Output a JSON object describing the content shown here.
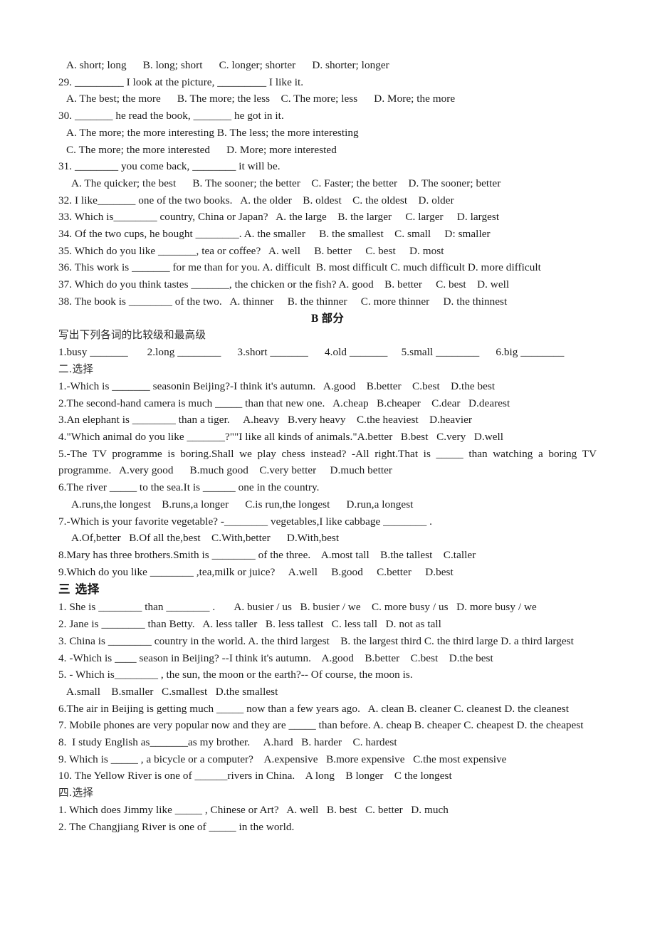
{
  "document": {
    "type": "english-grammar-worksheet",
    "topic": "comparatives-and-superlatives",
    "text_color": "#1a1a1a",
    "background_color": "#ffffff"
  },
  "section_a_continued": {
    "lines": [
      {
        "id": "q28-options",
        "indent": 1,
        "text": "A. short; long      B. long; short      C. longer; shorter      D. shorter; longer"
      },
      {
        "id": "q29-stem",
        "indent": 0,
        "text": "29. _________ I look at the picture, _________ I like it."
      },
      {
        "id": "q29-options",
        "indent": 1,
        "text": "A. The best; the more      B. The more; the less    C. The more; less      D. More; the more"
      },
      {
        "id": "q30-stem",
        "indent": 0,
        "text": "30. _______ he read the book, _______ he got in it."
      },
      {
        "id": "q30-options-ab",
        "indent": 1,
        "text": "A. The more; the more interesting B. The less; the more interesting"
      },
      {
        "id": "q30-options-cd",
        "indent": 1,
        "text": "C. The more; the more interested      D. More; more interested"
      },
      {
        "id": "q31-stem",
        "indent": 0,
        "text": "31. ________ you come back, ________ it will be."
      },
      {
        "id": "q31-options",
        "indent": 2,
        "text": "A. The quicker; the best      B. The sooner; the better    C. Faster; the better    D. The sooner; better"
      },
      {
        "id": "q32",
        "indent": 0,
        "text": "32. I like_______ one of the two books.   A. the older    B. oldest    C. the oldest    D. older"
      },
      {
        "id": "q33",
        "indent": 0,
        "text": "33. Which is________ country, China or Japan?   A. the large    B. the larger     C. larger     D. largest"
      },
      {
        "id": "q34",
        "indent": 0,
        "text": "34. Of the two cups, he bought ________. A. the smaller     B. the smallest    C. small     D: smaller"
      },
      {
        "id": "q35",
        "indent": 0,
        "text": "35. Which do you like _______, tea or coffee?   A. well     B. better     C. best     D. most"
      },
      {
        "id": "q36",
        "indent": 0,
        "text": "36. This work is _______ for me than for you. A. difficult  B. most difficult C. much difficult D. more difficult"
      },
      {
        "id": "q37",
        "indent": 0,
        "text": "37. Which do you think tastes _______, the chicken or the fish? A. good    B. better     C. best    D. well"
      },
      {
        "id": "q38",
        "indent": 0,
        "text": "38. The book is ________ of the two.   A. thinner     B. the thinner     C. more thinner     D. the thinnest"
      }
    ]
  },
  "section_b": {
    "heading": "B 部分",
    "instruction": "写出下列各词的比较级和最高级",
    "word_forms_line": "1.busy _______       2.long ________      3.short _______      4.old _______     5.small ________      6.big ________"
  },
  "section_two": {
    "heading": "二.选择",
    "lines": [
      {
        "id": "s2-q1",
        "indent": 0,
        "justify": false,
        "text": "1.-Which is _______ seasonin Beijing?-I think it's autumn.   A.good    B.better    C.best    D.the best"
      },
      {
        "id": "s2-q2",
        "indent": 0,
        "justify": false,
        "text": "2.The second-hand camera is much _____ than that new one.   A.cheap   B.cheaper    C.dear   D.dearest"
      },
      {
        "id": "s2-q3",
        "indent": 0,
        "justify": false,
        "text": "3.An elephant is ________ than a tiger.     A.heavy   B.very heavy    C.the heaviest    D.heavier"
      },
      {
        "id": "s2-q4",
        "indent": 0,
        "justify": false,
        "text": "4.\"Which animal do you like _______?\"\"I like all kinds of animals.\"A.better   B.best   C.very   D.well"
      },
      {
        "id": "s2-q5",
        "indent": 0,
        "justify": true,
        "text": "5.-The TV programme is boring.Shall we play chess instead? -All right.That is _____ than watching a boring TV programme.   A.very good      B.much good    C.very better     D.much better"
      },
      {
        "id": "s2-q6-stem",
        "indent": 0,
        "justify": false,
        "text": "6.The river _____ to the sea.It is ______ one in the country."
      },
      {
        "id": "s2-q6-options",
        "indent": 2,
        "justify": false,
        "text": "A.runs,the longest    B.runs,a longer      C.is run,the longest      D.run,a longest"
      },
      {
        "id": "s2-q7-stem",
        "indent": 0,
        "justify": false,
        "text": "7.-Which is your favorite vegetable? -________ vegetables,I like cabbage ________ ."
      },
      {
        "id": "s2-q7-options",
        "indent": 2,
        "justify": false,
        "text": "A.Of,better   B.Of all the,best    C.With,better      D.With,best"
      },
      {
        "id": "s2-q8",
        "indent": 0,
        "justify": false,
        "text": "8.Mary has three brothers.Smith is ________ of the three.    A.most tall    B.the tallest    C.taller"
      },
      {
        "id": "s2-q9",
        "indent": 0,
        "justify": false,
        "text": "9.Which do you like ________ ,tea,milk or juice?     A.well     B.good     C.better     D.best"
      }
    ]
  },
  "section_three": {
    "heading": "三 选择",
    "lines": [
      {
        "id": "s3-q1",
        "indent": 0,
        "text": "1. She is ________ than ________ .       A. busier / us   B. busier / we    C. more busy / us   D. more busy / we"
      },
      {
        "id": "s3-q2",
        "indent": 0,
        "text": "2. Jane is ________ than Betty.   A. less taller   B. less tallest   C. less tall   D. not as tall"
      },
      {
        "id": "s3-q3",
        "indent": 0,
        "text": "3. China is ________ country in the world. A. the third largest    B. the largest third C. the third large D. a third largest"
      },
      {
        "id": "s3-q4",
        "indent": 0,
        "text": "4. -Which is ____ season in Beijing? --I think it's autumn.    A.good    B.better    C.best    D.the best"
      },
      {
        "id": "s3-q5-stem",
        "indent": 0,
        "text": "5. - Which is________ , the sun, the moon or the earth?-- Of course, the moon is."
      },
      {
        "id": "s3-q5-options",
        "indent": 1,
        "text": "A.small    B.smaller   C.smallest   D.the smallest"
      },
      {
        "id": "s3-q6",
        "indent": 0,
        "text": "6.The air in Beijing is getting much _____ now than a few years ago.   A. clean B. cleaner C. cleanest D. the cleanest"
      },
      {
        "id": "s3-q7",
        "indent": 0,
        "text": "7. Mobile phones are very popular now and they are _____ than before. A. cheap B. cheaper C. cheapest D. the cheapest"
      },
      {
        "id": "s3-q8",
        "indent": 0,
        "text": "8.  I study English as_______as my brother.     A.hard   B. harder    C. hardest"
      },
      {
        "id": "s3-q9",
        "indent": 0,
        "text": "9. Which is _____ , a bicycle or a computer?    A.expensive   B.more expensive   C.the most expensive"
      },
      {
        "id": "s3-q10",
        "indent": 0,
        "text": "10. The Yellow River is one of ______rivers in China.    A long    B longer    C the longest"
      }
    ]
  },
  "section_four": {
    "heading": "四.选择",
    "lines": [
      {
        "id": "s4-q1",
        "indent": 0,
        "text": "1. Which does Jimmy like _____ , Chinese or Art?   A. well   B. best   C. better   D. much"
      },
      {
        "id": "s4-q2",
        "indent": 0,
        "text": "2. The Changjiang River is one of _____ in the world."
      }
    ]
  }
}
